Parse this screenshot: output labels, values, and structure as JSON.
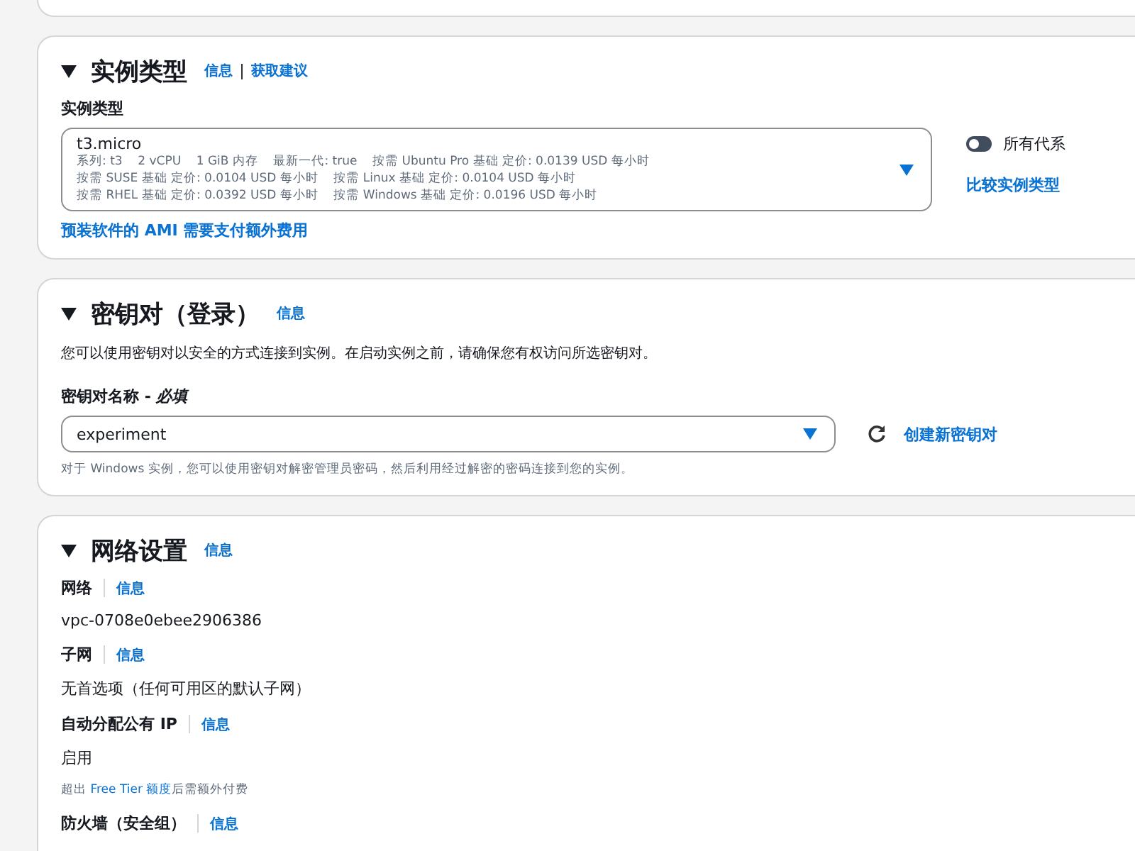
{
  "instance_type": {
    "title": "实例类型",
    "links": [
      "信息",
      "获取建议"
    ],
    "field_label": "实例类型",
    "selected_type": "t3.micro",
    "details": [
      "系列: t3    2 vCPU    1 GiB 内存    最新一代: true    按需 Ubuntu Pro 基础 定价: 0.0139 USD 每小时",
      "按需 SUSE 基础 定价: 0.0104 USD 每小时    按需 Linux 基础 定价: 0.0104 USD 每小时",
      "按需 RHEL 基础 定价: 0.0392 USD 每小时    按需 Windows 基础 定价: 0.0196 USD 每小时"
    ],
    "toggle": {
      "label": "所有代系",
      "on": false
    },
    "compare_link": "比较实例类型",
    "ami_note": "预装软件的 AMI 需要支付额外费用"
  },
  "key_pair": {
    "title": "密钥对（登录）",
    "info": "信息",
    "description": "您可以使用密钥对以安全的方式连接到实例。在启动实例之前，请确保您有权访问所选密钥对。",
    "field_label": "密钥对名称 - ",
    "required": "必填",
    "value": "experiment",
    "hint": "对于 Windows 实例，您可以使用密钥对解密管理员密码，然后利用经过解密的密码连接到您的实例。",
    "create_link": "创建新密钥对"
  },
  "network": {
    "title": "网络设置",
    "info": "信息",
    "fields": [
      {
        "label": "网络",
        "info": "信息",
        "value": "vpc-0708e0ebee2906386"
      },
      {
        "label": "子网",
        "info": "信息",
        "value": "无首选项（任何可用区的默认子网）"
      },
      {
        "label": "自动分配公有 IP",
        "info": "信息",
        "value": "启用",
        "note_before": "超出 ",
        "note_link": "Free Tier 额度",
        "note_after": "后需额外付费"
      },
      {
        "label": "防火墙（安全组）",
        "info": "信息"
      }
    ]
  }
}
